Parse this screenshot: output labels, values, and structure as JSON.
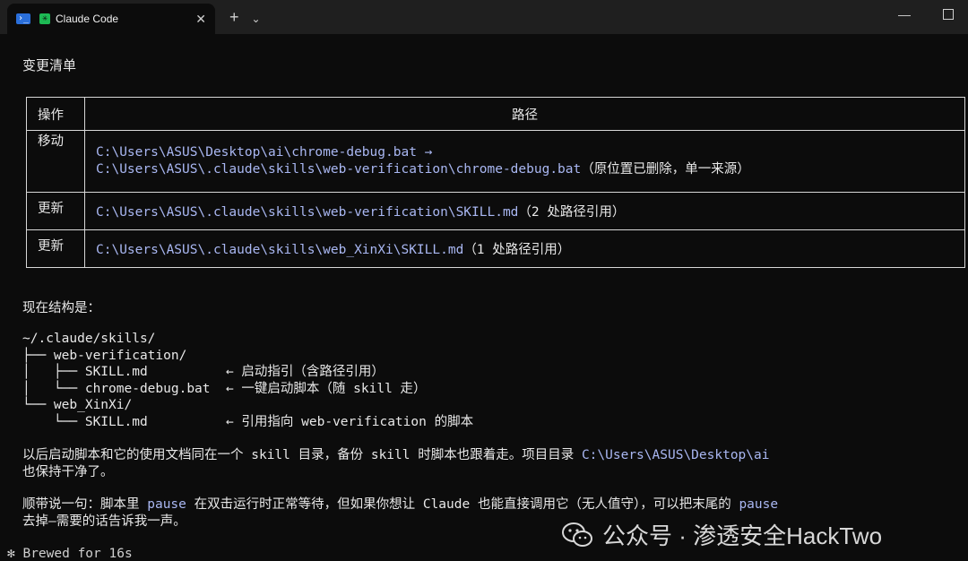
{
  "window": {
    "tab_title": "Claude Code",
    "close_glyph": "✕",
    "new_tab_glyph": "+",
    "dropdown_glyph": "⌄",
    "minimize_glyph": "—"
  },
  "heading": "变更清单",
  "table": {
    "headers": [
      "操作",
      "路径"
    ],
    "rows": [
      {
        "op": "移动",
        "path_line1": "C:\\Users\\ASUS\\Desktop\\ai\\chrome-debug.bat →",
        "path_line2": "C:\\Users\\ASUS\\.claude\\skills\\web-verification\\chrome-debug.bat",
        "note": "（原位置已删除，单一来源）"
      },
      {
        "op": "更新",
        "path": "C:\\Users\\ASUS\\.claude\\skills\\web-verification\\SKILL.md",
        "note": "（2 处路径引用）"
      },
      {
        "op": "更新",
        "path": "C:\\Users\\ASUS\\.claude\\skills\\web_XinXi\\SKILL.md",
        "note": "（1 处路径引用）"
      }
    ]
  },
  "structure_label": "现在结构是：",
  "tree": [
    "~/.claude/skills/",
    "├── web-verification/",
    "│   ├── SKILL.md          ← 启动指引（含路径引用）",
    "│   └── chrome-debug.bat  ← 一键启动脚本（随 skill 走）",
    "└── web_XinXi/",
    "    └── SKILL.md          ← 引用指向 web-verification 的脚本"
  ],
  "para1": {
    "text_a": "以后启动脚本和它的使用文档同在一个 skill 目录，备份 skill 时脚本也跟着走。项目目录 ",
    "path": "C:\\Users\\ASUS\\Desktop\\ai",
    "text_b": "也保持干净了。"
  },
  "para2": {
    "a": "顺带说一句：脚本里 ",
    "kw1": "pause",
    "b": " 在双击运行时正常等待，但如果你想让 Claude 也能直接调用它（无人值守），可以把末尾的 ",
    "kw2": "pause",
    "c": "去掉—需要的话告诉我一声。"
  },
  "status": "✻ Brewed for 16s",
  "watermark": "公众号 · 渗透安全HackTwo",
  "colors": {
    "background": "#0c0c0c",
    "path": "#a9b7f2",
    "text": "#e8e8e8"
  }
}
